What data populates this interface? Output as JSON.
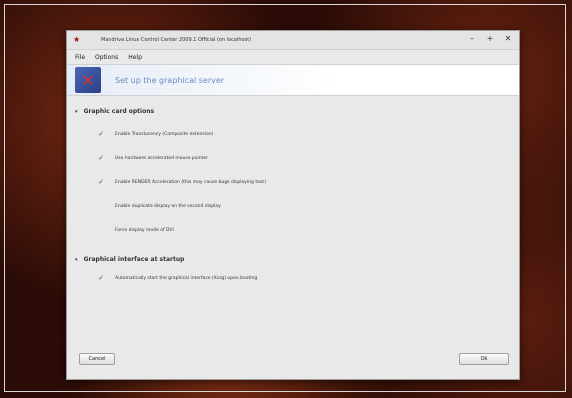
{
  "window": {
    "title": "Mandriva Linux Control Center 2009.1 Official (on localhost)",
    "controls": {
      "minimize": "–",
      "maximize": "+",
      "close": "✕"
    }
  },
  "menu": [
    "File",
    "Options",
    "Help"
  ],
  "banner": {
    "title": "Set up the graphical server"
  },
  "sections": [
    {
      "title": "Graphic card options",
      "options": [
        {
          "label": "Enable Translucency (Composite extension)",
          "checked": true
        },
        {
          "label": "Use hardware accelerated mouse pointer",
          "checked": true
        },
        {
          "label": "Enable RENDER Acceleration (this may cause bugs displaying text)",
          "checked": true
        },
        {
          "label": "Enable duplicate display on the second display",
          "checked": false
        },
        {
          "label": "Force display mode of DVI",
          "checked": false
        }
      ]
    },
    {
      "title": "Graphical interface at startup",
      "options": [
        {
          "label": "Automatically start the graphical interface (Xorg) upon booting",
          "checked": true
        }
      ]
    }
  ],
  "buttons": {
    "cancel": "Cancel",
    "ok": "Ok"
  },
  "icons": {
    "check": "✓",
    "app": "★",
    "banner": "✕"
  }
}
